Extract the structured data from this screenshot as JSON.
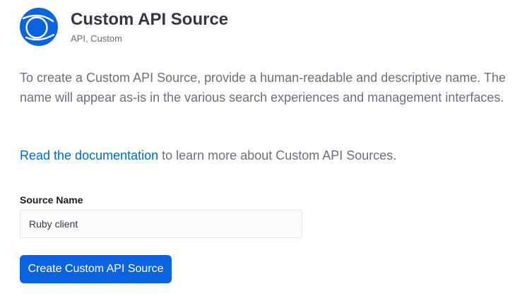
{
  "header": {
    "logo_icon": "custom-api-source-logo-icon",
    "title": "Custom API Source",
    "subtitle": "API, Custom"
  },
  "intro": {
    "description": "To create a Custom API Source, provide a human-readable and descriptive name. The name will appear as-is in the various search experiences and management interfaces.",
    "doc_link_text": "Read the documentation",
    "doc_suffix_text": " to learn more about Custom API Sources."
  },
  "form": {
    "source_name_label": "Source Name",
    "source_name_value": "Ruby client",
    "submit_label": "Create Custom API Source"
  },
  "colors": {
    "primary": "#0b64dd",
    "link": "#006bb8",
    "title_text": "#343741",
    "body_text": "#69707d"
  }
}
